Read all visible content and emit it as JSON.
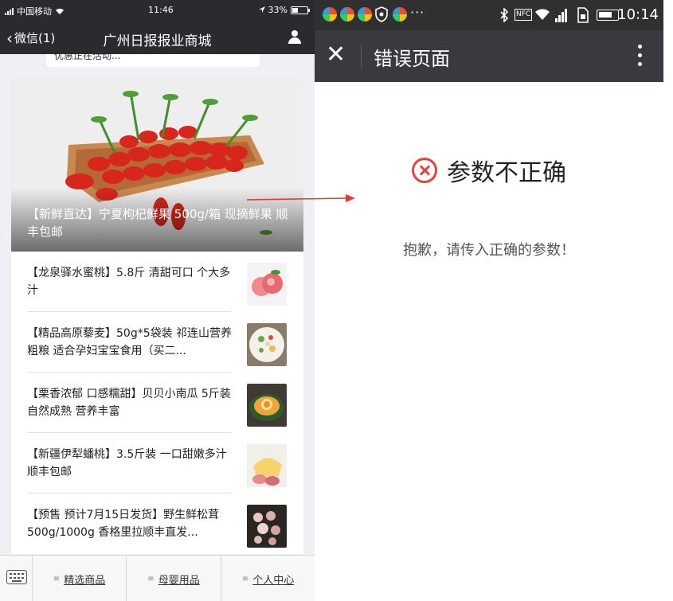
{
  "left_phone": {
    "status": {
      "carrier": "中国移动",
      "time": "11:46",
      "battery": "33%"
    },
    "nav": {
      "back_label": "微信(1)",
      "title": "广州日报报业商城",
      "user_icon": "user-icon"
    },
    "search_peek": "优惠正在活动...",
    "hero": {
      "caption": "【新鲜直达】宁夏枸杞鲜果 500g/箱 现摘鲜果 顺丰包邮"
    },
    "products": [
      {
        "title": "【龙泉驿水蜜桃】5.8斤 清甜可口 个大多汁",
        "thumb": "peach"
      },
      {
        "title": "【精品高原藜麦】50g*5袋装 祁连山营养粗粮 适合孕妇宝宝食用（买二...",
        "thumb": "salad"
      },
      {
        "title": "【栗香浓郁 口感糯甜】贝贝小南瓜 5斤装 自然成熟 营养丰富",
        "thumb": "pumpkin"
      },
      {
        "title": "【新疆伊犁蟠桃】3.5斤装 一口甜嫩多汁 顺丰包邮",
        "thumb": "flatpeach"
      },
      {
        "title": "【预售 预计7月15日发货】野生鲜松茸 500g/1000g 香格里拉顺丰直发...",
        "thumb": "matsutake"
      }
    ],
    "tabbar": {
      "keyboard_icon": "keyboard-icon",
      "tabs": [
        "精选商品",
        "母婴用品",
        "个人中心"
      ]
    }
  },
  "right_phone": {
    "status": {
      "time": "10:14",
      "ellipsis": "···",
      "nfc": "NFC"
    },
    "nav": {
      "title": "错误页面"
    },
    "error": {
      "title": "参数不正确",
      "message": "抱歉，请传入正确的参数！"
    }
  },
  "colors": {
    "wechat_nav": "#2b2b2f",
    "error_red": "#e64340",
    "arrow_red": "#e53935"
  }
}
